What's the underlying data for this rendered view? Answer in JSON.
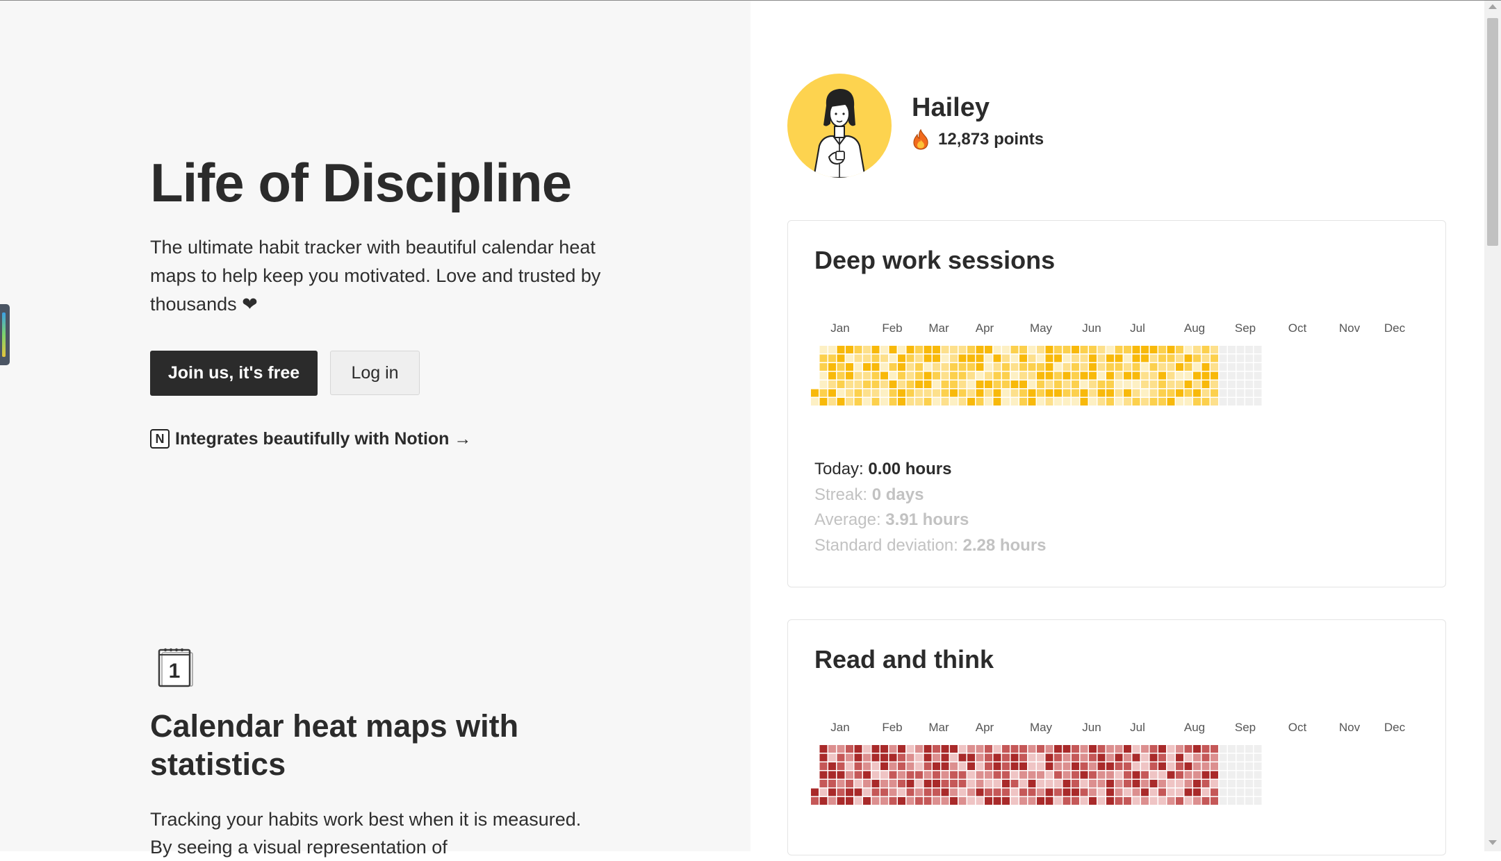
{
  "hero": {
    "title": "Life of Discipline",
    "description": "The ultimate habit tracker with beautiful calendar heat maps to help keep you motivated. Love and trusted by thousands ❤",
    "join_label": "Join us, it's free",
    "login_label": "Log in",
    "integrates_label": "Integrates beautifully with Notion →",
    "notion_icon_glyph": "N"
  },
  "feature": {
    "calendar_icon_glyph": "1",
    "title": "Calendar heat maps with statistics",
    "description": "Tracking your habits work best when it is measured. By seeing a visual representation of"
  },
  "profile": {
    "name": "Hailey",
    "points": "12,873 points",
    "avatar_color": "#fdd34f"
  },
  "months": [
    "Jan",
    "Feb",
    "Mar",
    "Apr",
    "May",
    "Jun",
    "Jul",
    "Aug",
    "Sep",
    "Oct",
    "Nov",
    "Dec"
  ],
  "cards": [
    {
      "title": "Deep work sessions",
      "palette": [
        "#efefef",
        "#fdf0c4",
        "#fde08c",
        "#fcd04d",
        "#f8b90a"
      ],
      "weeks_tracked": 47,
      "stats": [
        {
          "label": "Today: ",
          "value": "0.00 hours"
        },
        {
          "label": "Streak: ",
          "value": "0 days"
        },
        {
          "label": "Average: ",
          "value": "3.91 hours"
        },
        {
          "label": "Standard deviation: ",
          "value": "2.28 hours"
        }
      ]
    },
    {
      "title": "Read and think",
      "palette": [
        "#efefef",
        "#efc4c4",
        "#dc8f8f",
        "#c55858",
        "#a92a2a"
      ],
      "weeks_tracked": 47
    }
  ],
  "colors": {
    "dark_button": "#2b2b2b",
    "page_left": "#f7f7f7",
    "stat_dim": "#c2c2c2"
  }
}
